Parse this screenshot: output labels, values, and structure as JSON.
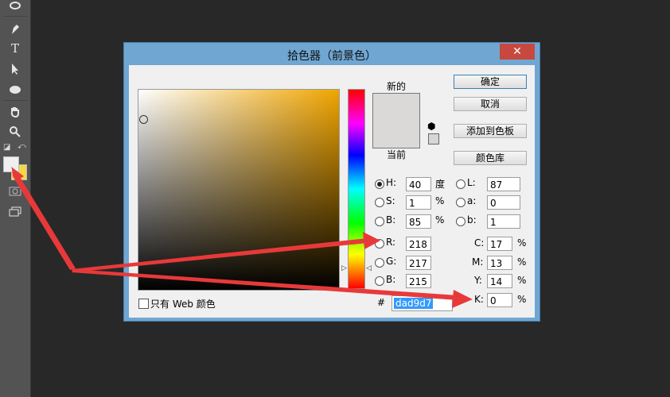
{
  "dialog": {
    "title": "拾色器（前景色）",
    "close": "✕",
    "new_label": "新的",
    "current_label": "当前",
    "buttons": {
      "ok": "确定",
      "cancel": "取消",
      "add_swatch": "添加到色板",
      "libraries": "颜色库"
    },
    "hsb": {
      "h_label": "H:",
      "h": "40",
      "h_unit": "度",
      "s_label": "S:",
      "s": "1",
      "s_unit": "%",
      "b_label": "B:",
      "b": "85",
      "b_unit": "%"
    },
    "lab": {
      "l_label": "L:",
      "l": "87",
      "a_label": "a:",
      "a": "0",
      "b_label": "b:",
      "b": "1"
    },
    "rgb": {
      "r_label": "R:",
      "r": "218",
      "g_label": "G:",
      "g": "217",
      "b_label": "B:",
      "b": "215"
    },
    "cmyk": {
      "c_label": "C:",
      "c": "17",
      "m_label": "M:",
      "m": "13",
      "y_label": "Y:",
      "y": "14",
      "k_label": "K:",
      "k": "0",
      "unit": "%"
    },
    "hex_label": "#",
    "hex": "dad9d7",
    "web_only": "只有 Web 颜色"
  },
  "colors": {
    "new": "#dad9d7",
    "current": "#dad9d7",
    "arrow": "#e8393a",
    "foreground": "#efefef",
    "background": "#f5d84a"
  },
  "toolbar": {
    "swap_icon": "swap-icon",
    "default_icon": "default-colors-icon"
  }
}
